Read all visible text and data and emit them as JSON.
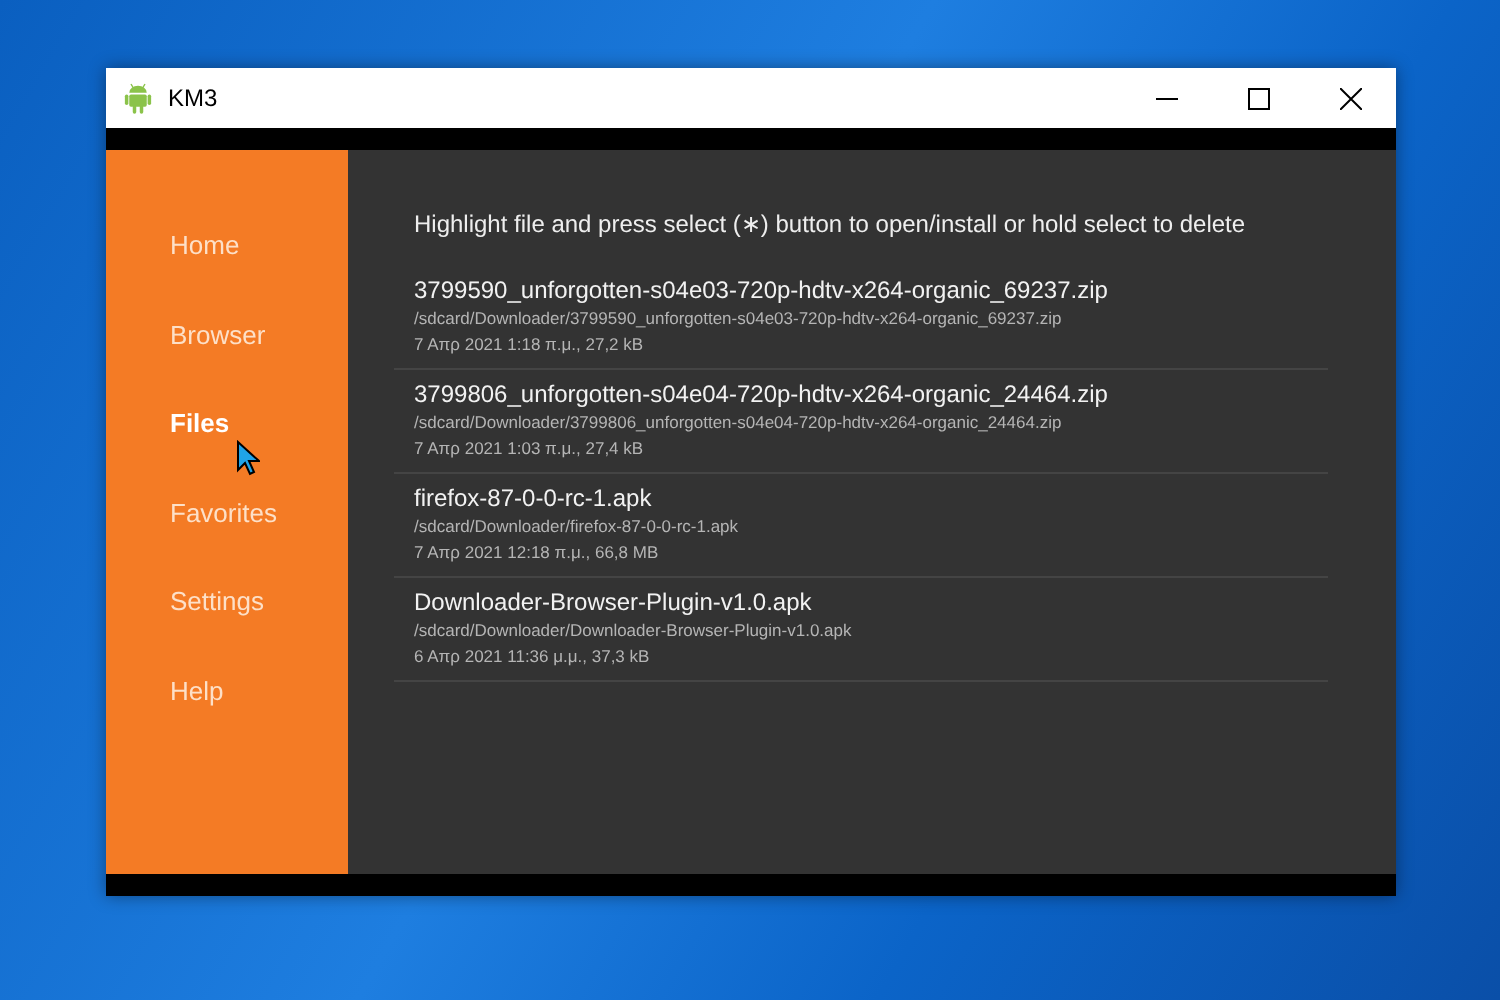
{
  "window": {
    "title": "KM3"
  },
  "sidebar": {
    "items": [
      {
        "label": "Home",
        "selected": false
      },
      {
        "label": "Browser",
        "selected": false
      },
      {
        "label": "Files",
        "selected": true
      },
      {
        "label": "Favorites",
        "selected": false
      },
      {
        "label": "Settings",
        "selected": false
      },
      {
        "label": "Help",
        "selected": false
      }
    ]
  },
  "hint": "Highlight file and press select (∗) button to open/install or hold select to delete",
  "files": [
    {
      "name": "3799590_unforgotten-s04e03-720p-hdtv-x264-organic_69237.zip",
      "path": "/sdcard/Downloader/3799590_unforgotten-s04e03-720p-hdtv-x264-organic_69237.zip",
      "info": "7 Απρ 2021 1:18 π.μ., 27,2 kB"
    },
    {
      "name": "3799806_unforgotten-s04e04-720p-hdtv-x264-organic_24464.zip",
      "path": "/sdcard/Downloader/3799806_unforgotten-s04e04-720p-hdtv-x264-organic_24464.zip",
      "info": "7 Απρ 2021 1:03 π.μ., 27,4 kB"
    },
    {
      "name": "firefox-87-0-0-rc-1.apk",
      "path": "/sdcard/Downloader/firefox-87-0-0-rc-1.apk",
      "info": "7 Απρ 2021 12:18 π.μ., 66,8 MB"
    },
    {
      "name": "Downloader-Browser-Plugin-v1.0.apk",
      "path": "/sdcard/Downloader/Downloader-Browser-Plugin-v1.0.apk",
      "info": "6 Απρ 2021 11:36 μ.μ., 37,3 kB"
    }
  ]
}
